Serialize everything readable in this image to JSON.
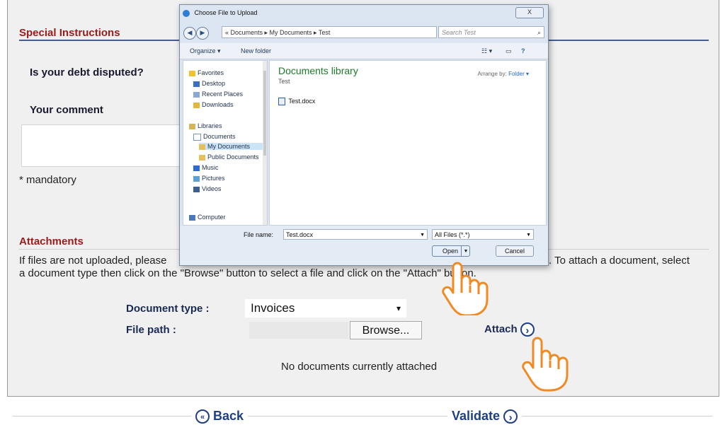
{
  "page": {
    "special_instructions": "Special Instructions",
    "debt_disputed_question": "Is your debt disputed?",
    "comment_label": "Your comment",
    "mandatory_note": "* mandatory",
    "attachments_title": "Attachments",
    "attachments_info_left": "If files are not uploaded, please",
    "attachments_info_right": ". To attach a document, select",
    "attachments_info_line2": "a document type then click on the \"Browse\" button to select a file and click on the \"Attach\" button.",
    "document_type_label": "Document type :",
    "document_type_value": "Invoices",
    "file_path_label": "File path :",
    "browse_label": "Browse...",
    "attach_label": "Attach",
    "no_documents": "No documents currently attached",
    "back_label": "Back",
    "validate_label": "Validate"
  },
  "dialog": {
    "title": "Choose File to Upload",
    "close_label": "X",
    "address_path": "« Documents ▸ My Documents ▸ Test",
    "search_placeholder": "Search Test",
    "organize_label": "Organize ▾",
    "new_folder_label": "New folder",
    "nav_items": [
      {
        "label": "Favorites",
        "icon": "star-icon"
      },
      {
        "label": "Desktop",
        "icon": "desktop-icon"
      },
      {
        "label": "Recent Places",
        "icon": "recent-places-icon"
      },
      {
        "label": "Downloads",
        "icon": "downloads-icon"
      },
      {
        "label": "Libraries",
        "icon": "libraries-icon"
      },
      {
        "label": "Documents",
        "icon": "documents-icon"
      },
      {
        "label": "My Documents",
        "icon": "folder-icon"
      },
      {
        "label": "Public Documents",
        "icon": "folder-icon"
      },
      {
        "label": "Music",
        "icon": "music-icon"
      },
      {
        "label": "Pictures",
        "icon": "pictures-icon"
      },
      {
        "label": "Videos",
        "icon": "videos-icon"
      },
      {
        "label": "Computer",
        "icon": "computer-icon"
      }
    ],
    "library_title": "Documents library",
    "library_subtitle": "Test",
    "arrange_by_label": "Arrange by:",
    "arrange_by_value": "Folder ▾",
    "file_name": "Test.docx",
    "file_name_label": "File name:",
    "file_name_value": "Test.docx",
    "file_type_value": "All Files (*.*)",
    "open_label": "Open",
    "cancel_label": "Cancel"
  },
  "colors": {
    "section_title": "#9b1b1b",
    "label_blue": "#1a2a55",
    "accent_blue": "#1e3f84",
    "cursor_orange": "#f08a24"
  }
}
